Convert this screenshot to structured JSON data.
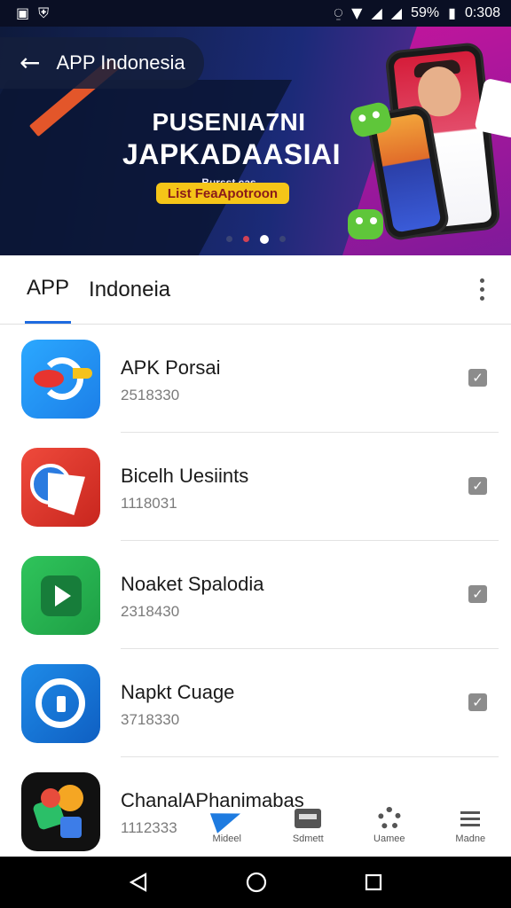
{
  "status_bar": {
    "left_icons": [
      "image-icon",
      "shield-icon"
    ],
    "battery": "59%",
    "time": "0:308"
  },
  "banner": {
    "title": "APP Indonesia",
    "headline_line1": "PUSENIA7NI",
    "headline_line2": "JAPKADAASIAI",
    "subtext": "Bursst cas",
    "badge": "List FeaApotroon",
    "carousel": {
      "count": 4,
      "active_index": 2
    }
  },
  "titlebar": {
    "tab": "APP",
    "title": "Indoneia"
  },
  "apps": [
    {
      "name": "APK Porsai",
      "meta": "2518330",
      "icon": "bird-refresh-icon"
    },
    {
      "name": "Bicelh Uesiints",
      "meta": "1118031",
      "icon": "paper-map-icon"
    },
    {
      "name": "Noaket Spalodia",
      "meta": "2318430",
      "icon": "play-icon"
    },
    {
      "name": "Napkt Cuage",
      "meta": "3718330",
      "icon": "chat-bubble-icon"
    },
    {
      "name": "ChanalAPhanimabas",
      "meta": "1112333",
      "icon": "colorful-blocks-icon"
    }
  ],
  "bottom_tabs": [
    {
      "label": "Mideel",
      "icon": "send-icon"
    },
    {
      "label": "Sdmett",
      "icon": "screen-icon"
    },
    {
      "label": "Uamee",
      "icon": "gear-icon"
    },
    {
      "label": "Madne",
      "icon": "menu-icon"
    }
  ],
  "colors": {
    "accent": "#1e6be0",
    "banner_dark": "#15245a",
    "banner_pink": "#c0159c",
    "badge": "#f5c518"
  }
}
